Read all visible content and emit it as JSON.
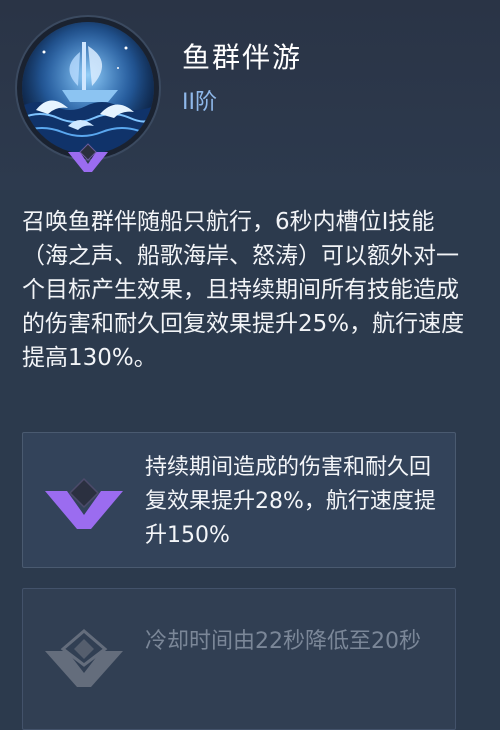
{
  "skill": {
    "name": "鱼群伴游",
    "tier": "II阶",
    "icon": "dolphin-ship-skill-icon",
    "description": "召唤鱼群伴随船只航行，6秒内槽位I技能（海之声、船歌海岸、怒涛）可以额外对一个目标产生效果，且持续期间所有技能造成的伤害和耐久回复效果提升25%，航行速度提高130%。"
  },
  "upgrades": [
    {
      "text": "持续期间造成的伤害和耐久回复效果提升28%，航行速度提升150%",
      "state": "active",
      "color": "#9b6cf0"
    },
    {
      "text": "冷却时间由22秒降低至20秒",
      "state": "locked",
      "color": "#6c7585"
    }
  ]
}
